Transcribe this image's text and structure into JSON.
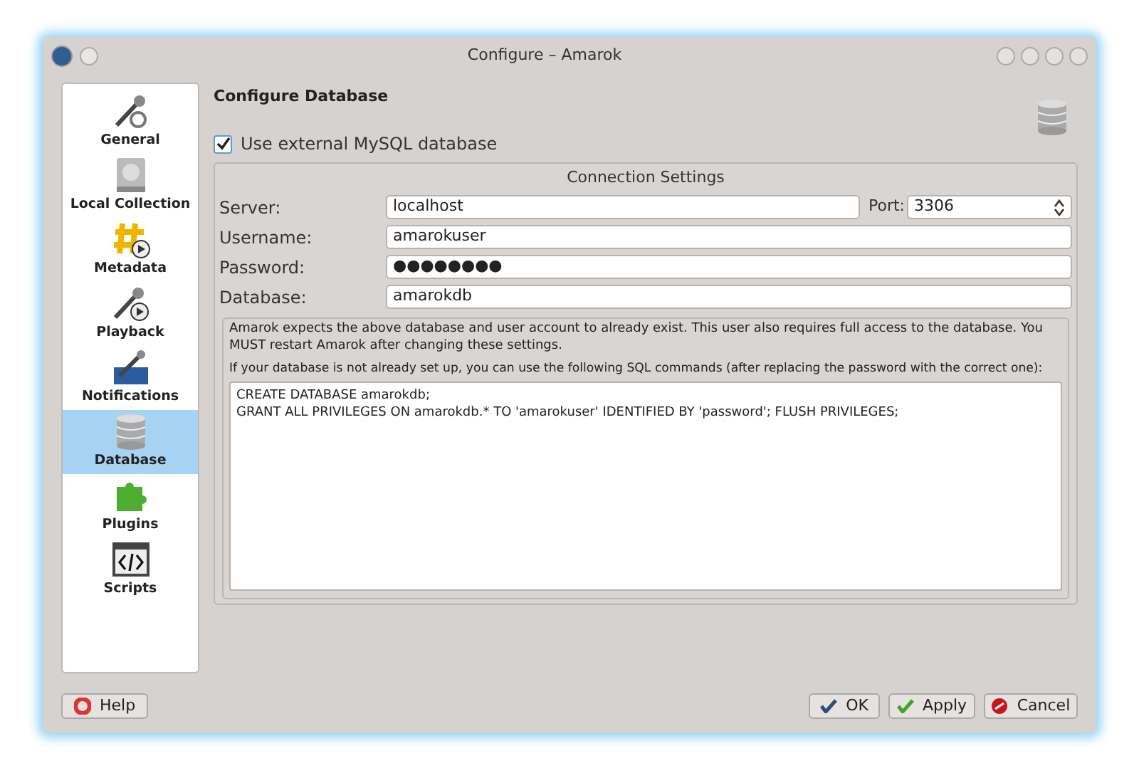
{
  "window": {
    "title": "Configure – Amarok"
  },
  "sidebar": {
    "items": [
      {
        "label": "General",
        "kind": "wrench",
        "selected": false
      },
      {
        "label": "Local Collection",
        "kind": "disk",
        "selected": false
      },
      {
        "label": "Metadata",
        "kind": "hash",
        "selected": false
      },
      {
        "label": "Playback",
        "kind": "play",
        "selected": false
      },
      {
        "label": "Notifications",
        "kind": "notify",
        "selected": false
      },
      {
        "label": "Database",
        "kind": "db",
        "selected": true
      },
      {
        "label": "Plugins",
        "kind": "puzzle",
        "selected": false
      },
      {
        "label": "Scripts",
        "kind": "code",
        "selected": false
      }
    ]
  },
  "page": {
    "heading": "Configure Database",
    "use_external": {
      "label": "Use external MySQL database",
      "checked": true
    },
    "connection": {
      "title": "Connection Settings",
      "server": {
        "label": "Server:",
        "value": "localhost"
      },
      "port": {
        "label": "Port:",
        "value": "3306"
      },
      "username": {
        "label": "Username:",
        "value": "amarokuser"
      },
      "password": {
        "label": "Password:",
        "value": "●●●●●●●●"
      },
      "database": {
        "label": "Database:",
        "value": "amarokdb"
      }
    },
    "info": "Amarok expects the above database and user account to already exist. This user also requires full access to the database. You MUST restart Amarok after changing these settings.",
    "sql_hint": "If your database is not already set up, you can use the following SQL commands (after replacing the password with the correct one):",
    "sql_lines": [
      "CREATE DATABASE amarokdb;",
      "GRANT ALL PRIVILEGES ON amarokdb.* TO 'amarokuser' IDENTIFIED BY 'password'; FLUSH PRIVILEGES;"
    ]
  },
  "buttons": {
    "help": "Help",
    "ok": "OK",
    "apply": "Apply",
    "cancel": "Cancel"
  }
}
